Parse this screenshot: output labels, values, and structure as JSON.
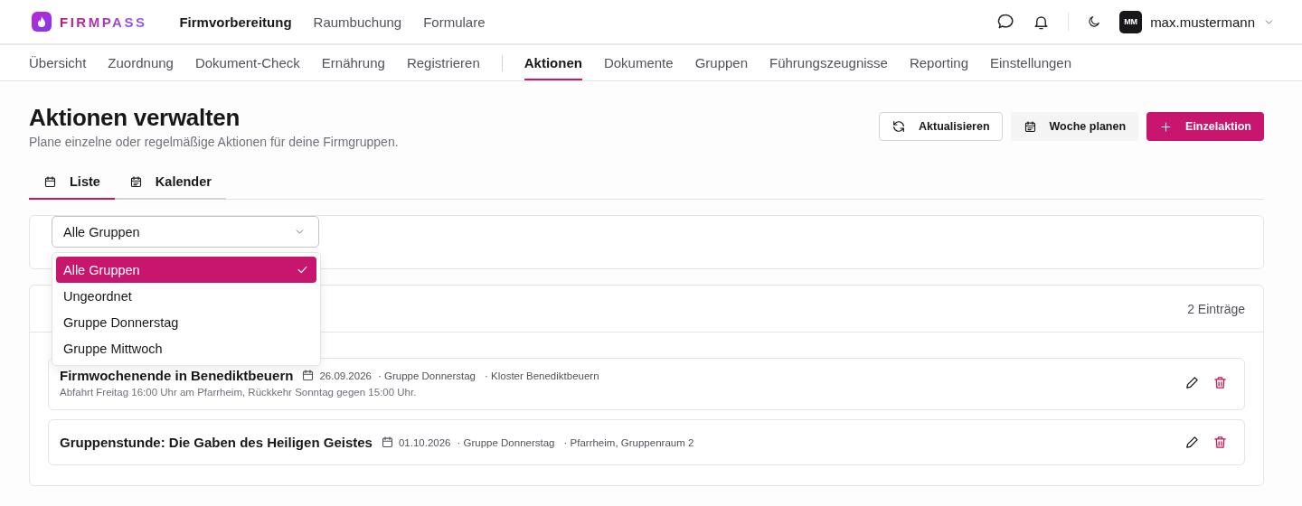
{
  "brand": {
    "name": "FIRMPASS"
  },
  "main_nav": [
    {
      "label": "Firmvorbereitung",
      "selected": true
    },
    {
      "label": "Raumbuchung",
      "selected": false
    },
    {
      "label": "Formulare",
      "selected": false
    }
  ],
  "user": {
    "initials": "MM",
    "name": "max.mustermann"
  },
  "sub_nav": [
    {
      "label": "Übersicht",
      "selected": false
    },
    {
      "label": "Zuordnung",
      "selected": false
    },
    {
      "label": "Dokument-Check",
      "selected": false
    },
    {
      "label": "Ernährung",
      "selected": false
    },
    {
      "label": "Registrieren",
      "selected": false
    },
    {
      "label": "Aktionen",
      "selected": true
    },
    {
      "label": "Dokumente",
      "selected": false
    },
    {
      "label": "Gruppen",
      "selected": false
    },
    {
      "label": "Führungszeugnisse",
      "selected": false
    },
    {
      "label": "Reporting",
      "selected": false
    },
    {
      "label": "Einstellungen",
      "selected": false
    }
  ],
  "page": {
    "title": "Aktionen verwalten",
    "subtitle": "Plane einzelne oder regelmäßige Aktionen für deine Firmgruppen."
  },
  "actions": [
    {
      "kind": "refresh",
      "label": "Aktualisieren"
    },
    {
      "kind": "plan",
      "label": "Woche planen"
    },
    {
      "kind": "add",
      "label": "Einzelaktion"
    }
  ],
  "view_tabs": [
    {
      "kind": "list",
      "label": "Liste",
      "selected": true
    },
    {
      "kind": "calendar",
      "label": "Kalender",
      "selected": false
    }
  ],
  "filter": {
    "value": "Alle Gruppen",
    "expanded": true,
    "options": [
      {
        "label": "Alle Gruppen",
        "selected": true
      },
      {
        "label": "Ungeordnet",
        "selected": false
      },
      {
        "label": "Gruppe Donnerstag",
        "selected": false
      },
      {
        "label": "Gruppe Mittwoch",
        "selected": false
      }
    ]
  },
  "list": {
    "count": "2 Einträge",
    "events": [
      {
        "title": "Firmwochenende in Benediktbeuern",
        "date": "26.09.2026",
        "group": "· Gruppe Donnerstag",
        "place": "· Kloster Benediktbeuern",
        "note": "Abfahrt Freitag 16:00 Uhr am Pfarrheim, Rückkehr Sonntag gegen 15:00 Uhr."
      },
      {
        "title": "Gruppenstunde: Die Gaben des Heiligen Geistes",
        "date": "01.10.2026",
        "group": "· Gruppe Donnerstag",
        "place": "· Pfarrheim, Gruppenraum 2"
      }
    ]
  }
}
